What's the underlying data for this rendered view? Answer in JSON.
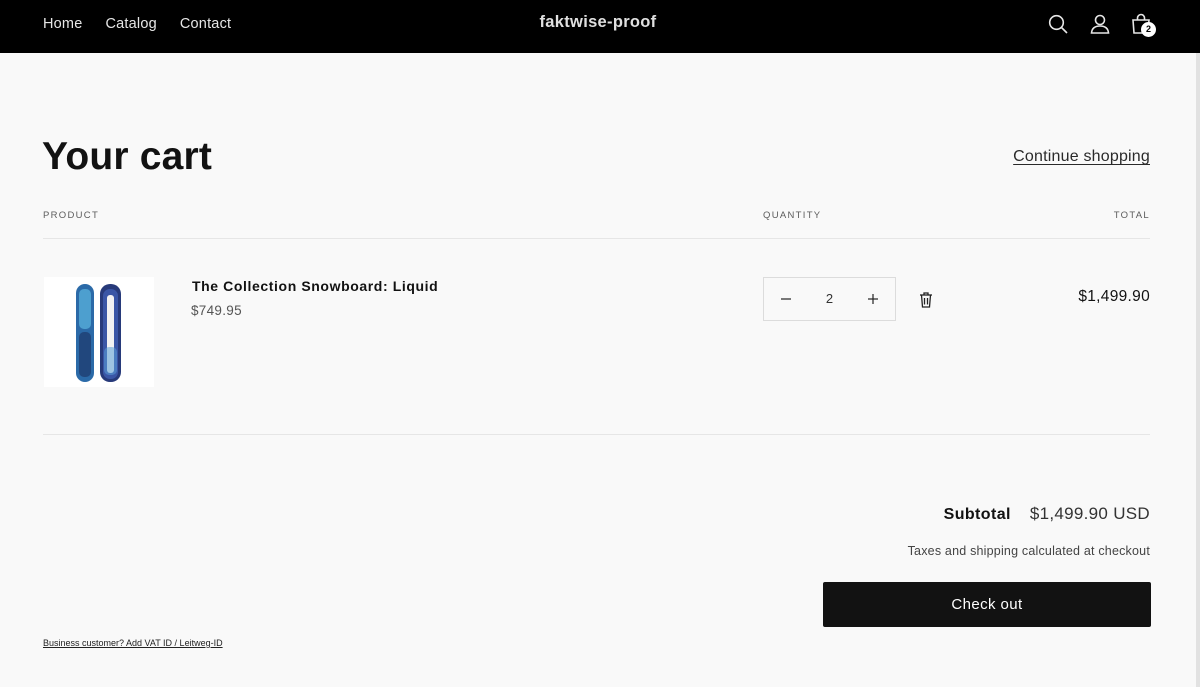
{
  "header": {
    "nav": [
      {
        "label": "Home"
      },
      {
        "label": "Catalog"
      },
      {
        "label": "Contact"
      }
    ],
    "brand": "faktwise-proof",
    "icons": [
      "search-icon",
      "account-icon",
      "cart-icon"
    ],
    "cart_count": "2"
  },
  "cart": {
    "title": "Your cart",
    "continue_label": "Continue shopping",
    "columns": {
      "product": "PRODUCT",
      "quantity": "QUANTITY",
      "total": "TOTAL"
    },
    "items": [
      {
        "name": "The Collection Snowboard: Liquid",
        "price": "$749.95",
        "quantity": "2",
        "line_total": "$1,499.90",
        "image_icon": "snowboard-image"
      }
    ]
  },
  "summary": {
    "subtotal_label": "Subtotal",
    "subtotal_value": "$1,499.90 USD",
    "tax_note": "Taxes and shipping calculated at checkout",
    "checkout_label": "Check out"
  },
  "footer": {
    "vat_link": "Business customer? Add VAT ID / Leitweg-ID"
  },
  "colors": {
    "header_bg": "#000000",
    "page_bg": "#f9f9f9",
    "button_bg": "#121212",
    "text": "#121212"
  }
}
